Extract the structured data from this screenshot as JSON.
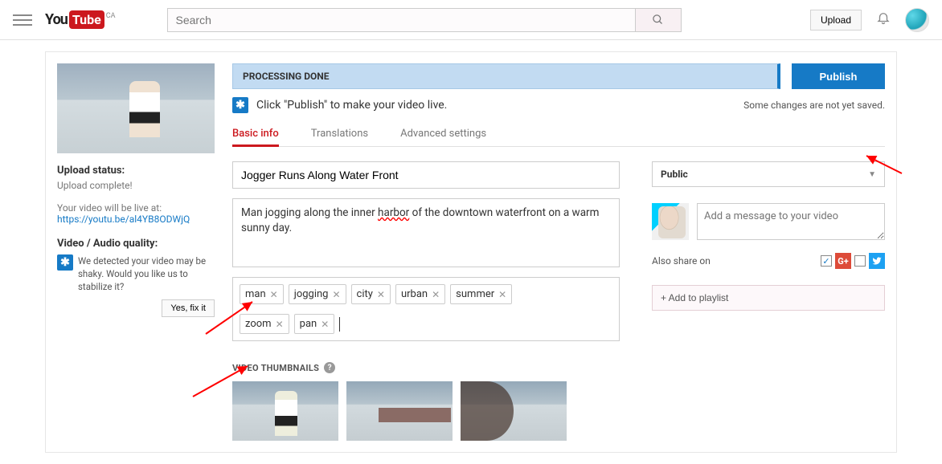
{
  "header": {
    "logo_you": "You",
    "logo_tube": "Tube",
    "region": "CA",
    "search_placeholder": "Search",
    "upload_label": "Upload"
  },
  "left": {
    "upload_status_title": "Upload status:",
    "upload_status_text": "Upload complete!",
    "live_text": "Your video will be live at:",
    "video_url": "https://youtu.be/al4YB8ODWjQ",
    "quality_title": "Video / Audio quality:",
    "quality_msg": "We detected your video may be shaky. Would you like us to stabilize it?",
    "fix_label": "Yes, fix it"
  },
  "top": {
    "status": "PROCESSING DONE",
    "publish_label": "Publish",
    "info_text": "Click \"Publish\" to make your video live.",
    "save_warn": "Some changes are not yet saved."
  },
  "tabs": {
    "basic": "Basic info",
    "translations": "Translations",
    "advanced": "Advanced settings"
  },
  "form": {
    "title": "Jogger Runs Along Water Front",
    "description": "Man jogging along the inner harbor of the downtown waterfront on a warm sunny day.",
    "tags": [
      "man",
      "jogging",
      "city",
      "urban",
      "summer",
      "zoom",
      "pan"
    ],
    "thumbnails_header": "VIDEO THUMBNAILS"
  },
  "side": {
    "privacy": "Public",
    "message_placeholder": "Add a message to your video",
    "also_share": "Also share on",
    "playlist_label": "+ Add to playlist"
  }
}
